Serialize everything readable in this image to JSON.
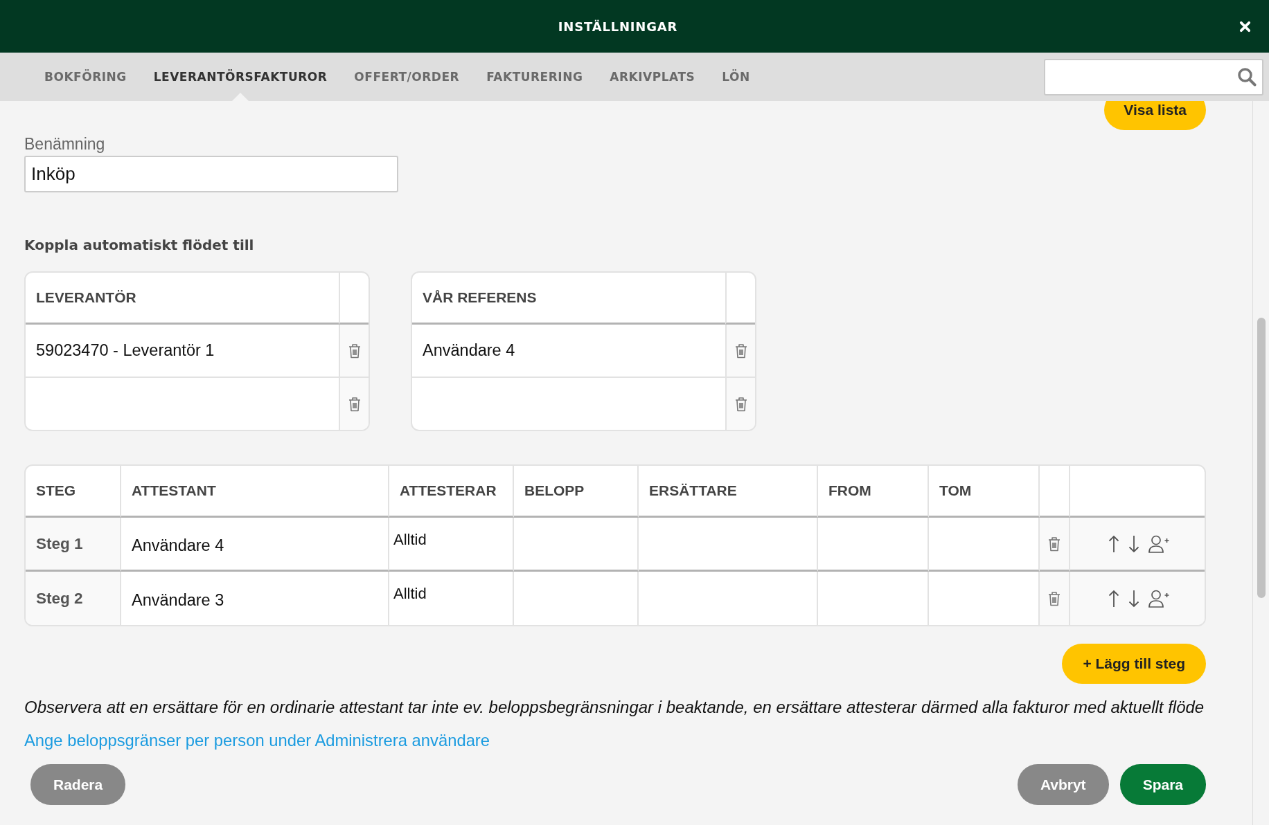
{
  "window": {
    "title": "INSTÄLLNINGAR"
  },
  "tabs": [
    {
      "label": "BOKFÖRING",
      "selected": false
    },
    {
      "label": "LEVERANTÖRSFAKTUROR",
      "selected": true
    },
    {
      "label": "OFFERT/ORDER",
      "selected": false
    },
    {
      "label": "FAKTURERING",
      "selected": false
    },
    {
      "label": "ARKIVPLATS",
      "selected": false
    },
    {
      "label": "LÖN",
      "selected": false
    }
  ],
  "top_button": {
    "label": "Visa lista",
    "kind": "accent"
  },
  "name_field": {
    "label": "Benämning",
    "value": "Inköp"
  },
  "auto_link": {
    "heading": "Koppla automatiskt flödet till",
    "tables": [
      {
        "column": "LEVERANTÖR",
        "rows": [
          {
            "value": "59023470 - Leverantör 1"
          },
          {
            "value": null
          }
        ]
      },
      {
        "column": "VÅR REFERENS",
        "rows": [
          {
            "value": "Användare 4"
          },
          {
            "value": null
          }
        ]
      }
    ]
  },
  "steps_table": {
    "columns": [
      "STEG",
      "ATTESTANT",
      "ATTESTERAR",
      "BELOPP",
      "ERSÄTTARE",
      "FROM",
      "TOM"
    ],
    "rows": [
      {
        "step": "Steg 1",
        "attestant": "Användare 4",
        "attesterar": "Alltid"
      },
      {
        "step": "Steg 2",
        "attestant": "Användare 3",
        "attesterar": "Alltid"
      }
    ]
  },
  "add_step_button": {
    "label": "+ Lägg till steg",
    "kind": "accent"
  },
  "note": "Observera att en ersättare för en ordinarie attestant tar inte ev. beloppsbegränsningar i beaktande, en ersättare attesterar därmed alla fakturor med aktuellt flöde",
  "link": "Ange beloppsgränser per person under Administrera användare",
  "footer": {
    "left_buttons": [
      {
        "label": "Radera",
        "kind": "secondary"
      }
    ],
    "right_buttons": [
      {
        "label": "Avbryt",
        "kind": "secondary"
      },
      {
        "label": "Spara",
        "kind": "primary"
      }
    ]
  }
}
